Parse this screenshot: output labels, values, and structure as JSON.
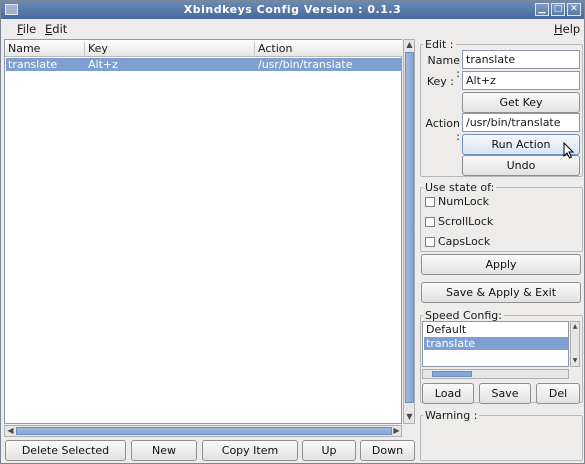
{
  "window": {
    "title": "Xbindkeys Config Version : 0.1.3",
    "controls": [
      "minimize",
      "maximize",
      "close"
    ]
  },
  "menubar": {
    "file_label_accel": "F",
    "file_label_rest": "ile",
    "edit_label_accel": "E",
    "edit_label_rest": "dit",
    "help_label_accel": "H",
    "help_label_rest": "elp"
  },
  "bindings_table": {
    "columns": [
      "Name",
      "Key",
      "Action"
    ],
    "rows": [
      {
        "name": "translate",
        "key": "Alt+z",
        "action": "/usr/bin/translate",
        "selected": true
      }
    ]
  },
  "bottom_buttons": {
    "delete_selected": "Delete Selected",
    "new": "New",
    "copy_item": "Copy Item",
    "up": "Up",
    "down": "Down"
  },
  "edit_group": {
    "title": "Edit :",
    "name_label": "Name :",
    "name_value": "translate",
    "key_label": "Key :",
    "key_value": "Alt+z",
    "get_key": "Get Key",
    "action_label": "Action :",
    "action_value": "/usr/bin/translate",
    "run_action": "Run Action",
    "undo": "Undo"
  },
  "state_group": {
    "title": "Use state of:",
    "options": [
      {
        "label": "NumLock",
        "checked": false
      },
      {
        "label": "ScrollLock",
        "checked": false
      },
      {
        "label": "CapsLock",
        "checked": false
      }
    ]
  },
  "actions": {
    "apply": "Apply",
    "save_apply_exit": "Save & Apply & Exit"
  },
  "speed_config": {
    "title": "Speed Config:",
    "items": [
      {
        "label": "Default",
        "selected": false
      },
      {
        "label": "translate",
        "selected": true
      }
    ],
    "load": "Load",
    "save": "Save",
    "del": "Del"
  },
  "warning": {
    "title": "Warning :"
  },
  "colors": {
    "selection": "#7e9fd2",
    "titlebar": "#48699a",
    "background": "#edecea"
  }
}
